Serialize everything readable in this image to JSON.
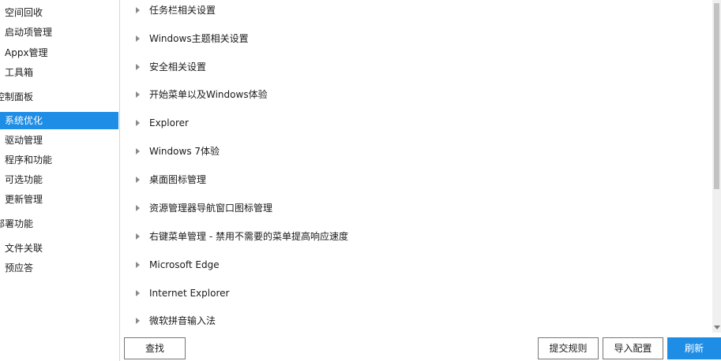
{
  "sidebar": {
    "items": [
      {
        "label": "空间回收"
      },
      {
        "label": "启动项管理"
      },
      {
        "label": "Appx管理"
      },
      {
        "label": "工具箱"
      },
      {
        "label": "控制面板"
      },
      {
        "label": "系统优化"
      },
      {
        "label": "驱动管理"
      },
      {
        "label": "程序和功能"
      },
      {
        "label": "可选功能"
      },
      {
        "label": "更新管理"
      },
      {
        "label": "部署功能"
      },
      {
        "label": "文件关联"
      },
      {
        "label": "预应答"
      }
    ],
    "selected": "系统优化",
    "accent_color": "#1e8de6"
  },
  "tree": {
    "items": [
      {
        "label": "任务栏相关设置"
      },
      {
        "label": "Windows主题相关设置"
      },
      {
        "label": "安全相关设置"
      },
      {
        "label": "开始菜单以及Windows体验"
      },
      {
        "label": "Explorer"
      },
      {
        "label": "Windows 7体验"
      },
      {
        "label": "桌面图标管理"
      },
      {
        "label": "资源管理器导航窗口图标管理"
      },
      {
        "label": "右键菜单管理 - 禁用不需要的菜单提高响应速度"
      },
      {
        "label": "Microsoft Edge"
      },
      {
        "label": "Internet Explorer"
      },
      {
        "label": "微软拼音输入法"
      }
    ]
  },
  "buttons": {
    "search": "查找",
    "submit_rules": "提交规则",
    "import_config": "导入配置",
    "refresh": "刷新"
  }
}
